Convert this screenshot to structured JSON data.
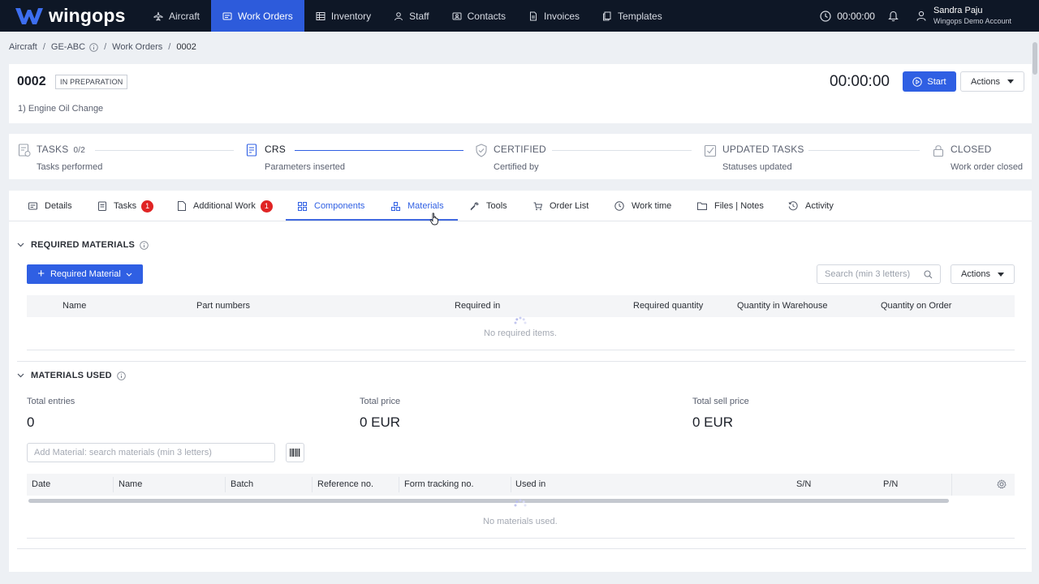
{
  "app": {
    "logo_text": "wingops",
    "brand_color": "#2f5fe3",
    "nav_bg": "#0e1726"
  },
  "nav": {
    "items": [
      {
        "label": "Aircraft",
        "icon": "plane-icon"
      },
      {
        "label": "Work Orders",
        "icon": "work-orders-icon"
      },
      {
        "label": "Inventory",
        "icon": "inventory-icon"
      },
      {
        "label": "Staff",
        "icon": "staff-icon"
      },
      {
        "label": "Contacts",
        "icon": "contacts-icon"
      },
      {
        "label": "Invoices",
        "icon": "invoices-icon"
      },
      {
        "label": "Templates",
        "icon": "templates-icon"
      }
    ],
    "active": "Work Orders",
    "timer": "00:00:00",
    "user_name": "Sandra Paju",
    "user_account": "Wingops Demo Account"
  },
  "breadcrumb": [
    "Aircraft",
    "GE-ABC",
    "Work Orders",
    "0002"
  ],
  "header": {
    "number": "0002",
    "status": "IN PREPARATION",
    "description": "1) Engine Oil Change",
    "timer": "00:00:00",
    "start_label": "Start",
    "actions_label": "Actions"
  },
  "steps": [
    {
      "title": "TASKS",
      "count": "0/2",
      "sub": "Tasks performed",
      "icon": "tasks-icon"
    },
    {
      "title": "CRS",
      "sub": "Parameters inserted",
      "icon": "crs-document-icon"
    },
    {
      "title": "CERTIFIED",
      "sub": "Certified by",
      "icon": "shield-check-icon"
    },
    {
      "title": "UPDATED TASKS",
      "sub": "Statuses updated",
      "icon": "checkbox-icon"
    },
    {
      "title": "CLOSED",
      "sub": "Work order closed",
      "icon": "lock-icon"
    }
  ],
  "tabs": [
    {
      "label": "Details"
    },
    {
      "label": "Tasks",
      "badge": "1"
    },
    {
      "label": "Additional Work",
      "badge": "1"
    },
    {
      "label": "Components"
    },
    {
      "label": "Materials"
    },
    {
      "label": "Tools"
    },
    {
      "label": "Order List"
    },
    {
      "label": "Work time"
    },
    {
      "label": "Files | Notes"
    },
    {
      "label": "Activity"
    }
  ],
  "required": {
    "title": "REQUIRED MATERIALS",
    "add_label": "Required Material",
    "search_placeholder": "Search (min 3 letters)",
    "actions_label": "Actions",
    "columns": [
      "Name",
      "Part numbers",
      "Required in",
      "Required quantity",
      "Quantity in Warehouse",
      "Quantity on Order"
    ],
    "empty": "No required items."
  },
  "used": {
    "title": "MATERIALS USED",
    "stats": [
      {
        "label": "Total entries",
        "value": "0"
      },
      {
        "label": "Total price",
        "value": "0 EUR"
      },
      {
        "label": "Total sell price",
        "value": "0 EUR"
      }
    ],
    "add_placeholder": "Add Material: search materials (min 3 letters)",
    "columns": [
      "Date",
      "Name",
      "Batch",
      "Reference no.",
      "Form tracking no.",
      "Used in",
      "S/N",
      "P/N"
    ],
    "empty": "No materials used."
  }
}
